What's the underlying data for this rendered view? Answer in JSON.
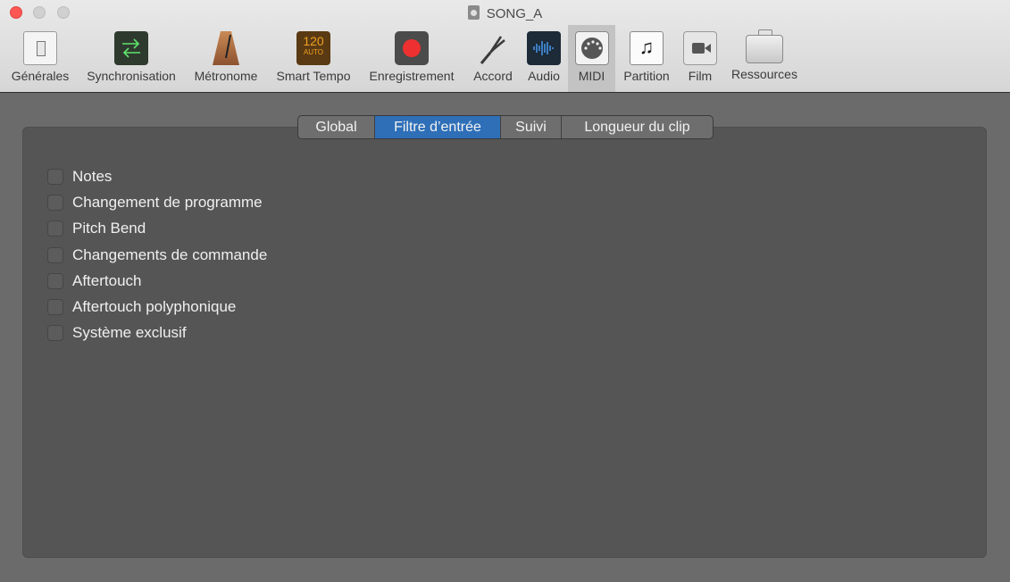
{
  "window": {
    "title": "SONG_A"
  },
  "toolbar": {
    "items": [
      {
        "label": "Générales",
        "icon": "general-switch-icon"
      },
      {
        "label": "Synchronisation",
        "icon": "sync-arrows-icon"
      },
      {
        "label": "Métronome",
        "icon": "metronome-icon"
      },
      {
        "label": "Smart Tempo",
        "icon": "smart-tempo-icon",
        "value": "120",
        "sub": "AUTO"
      },
      {
        "label": "Enregistrement",
        "icon": "record-icon"
      },
      {
        "label": "Accord",
        "icon": "tuning-fork-icon"
      },
      {
        "label": "Audio",
        "icon": "audio-waveform-icon"
      },
      {
        "label": "MIDI",
        "icon": "midi-connector-icon",
        "selected": true
      },
      {
        "label": "Partition",
        "icon": "music-note-icon"
      },
      {
        "label": "Film",
        "icon": "video-camera-icon"
      },
      {
        "label": "Ressources",
        "icon": "briefcase-icon"
      }
    ]
  },
  "tabs": [
    {
      "label": "Global",
      "active": false
    },
    {
      "label": "Filtre d’entrée",
      "active": true
    },
    {
      "label": "Suivi",
      "active": false
    },
    {
      "label": "Longueur du clip",
      "active": false
    }
  ],
  "filters": [
    {
      "label": "Notes",
      "checked": false
    },
    {
      "label": "Changement de programme",
      "checked": false
    },
    {
      "label": "Pitch Bend",
      "checked": false
    },
    {
      "label": "Changements de commande",
      "checked": false
    },
    {
      "label": "Aftertouch",
      "checked": false
    },
    {
      "label": "Aftertouch polyphonique",
      "checked": false
    },
    {
      "label": "Système exclusif",
      "checked": false
    }
  ],
  "colors": {
    "accent": "#2e6fb8",
    "close": "#fc5753",
    "record": "#ee3030",
    "tempo": "#f0a024"
  }
}
